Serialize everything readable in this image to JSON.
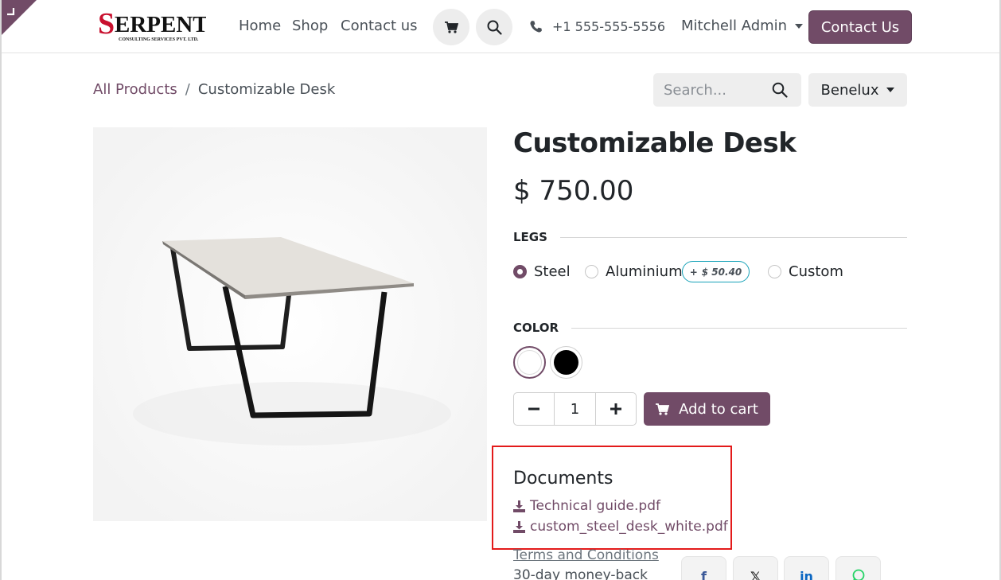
{
  "header": {
    "logo_alt": "SERPENT CONSULTING SERVICES PVT. LTD.",
    "nav": [
      "Home",
      "Shop",
      "Contact us"
    ],
    "cart_icon": "cart-icon",
    "search_icon": "search-icon",
    "phone": "+1 555-555-5556",
    "user": "Mitchell Admin",
    "cta": "Contact Us"
  },
  "breadcrumb": {
    "parent": "All Products",
    "separator": "/",
    "current": "Customizable Desk"
  },
  "search": {
    "placeholder": "Search..."
  },
  "pricelist": {
    "selected": "Benelux"
  },
  "product": {
    "name": "Customizable Desk",
    "price": "$ 750.00",
    "attributes": {
      "legs": {
        "label": "LEGS",
        "options": [
          "Steel",
          "Aluminium",
          "Custom"
        ],
        "selected": "Steel",
        "extra_price_sign": "+",
        "extra_price": "$ 50.40"
      },
      "color": {
        "label": "COLOR",
        "options": [
          {
            "name": "White",
            "hex": "#ffffff"
          },
          {
            "name": "Black",
            "hex": "#000000"
          }
        ],
        "selected": "White"
      }
    },
    "quantity": "1",
    "add_to_cart": "Add to cart"
  },
  "documents": {
    "title": "Documents",
    "files": [
      "Technical guide.pdf",
      "custom_steel_desk_white.pdf"
    ]
  },
  "footer_info": {
    "terms": "Terms and Conditions",
    "guarantee": "30-day money-back"
  },
  "share": [
    "facebook-icon",
    "x-icon",
    "linkedin-icon",
    "whatsapp-icon"
  ],
  "colors": {
    "brand": "#714b67",
    "badge_border": "#17a2b8",
    "highlight": "#e31a1a"
  }
}
